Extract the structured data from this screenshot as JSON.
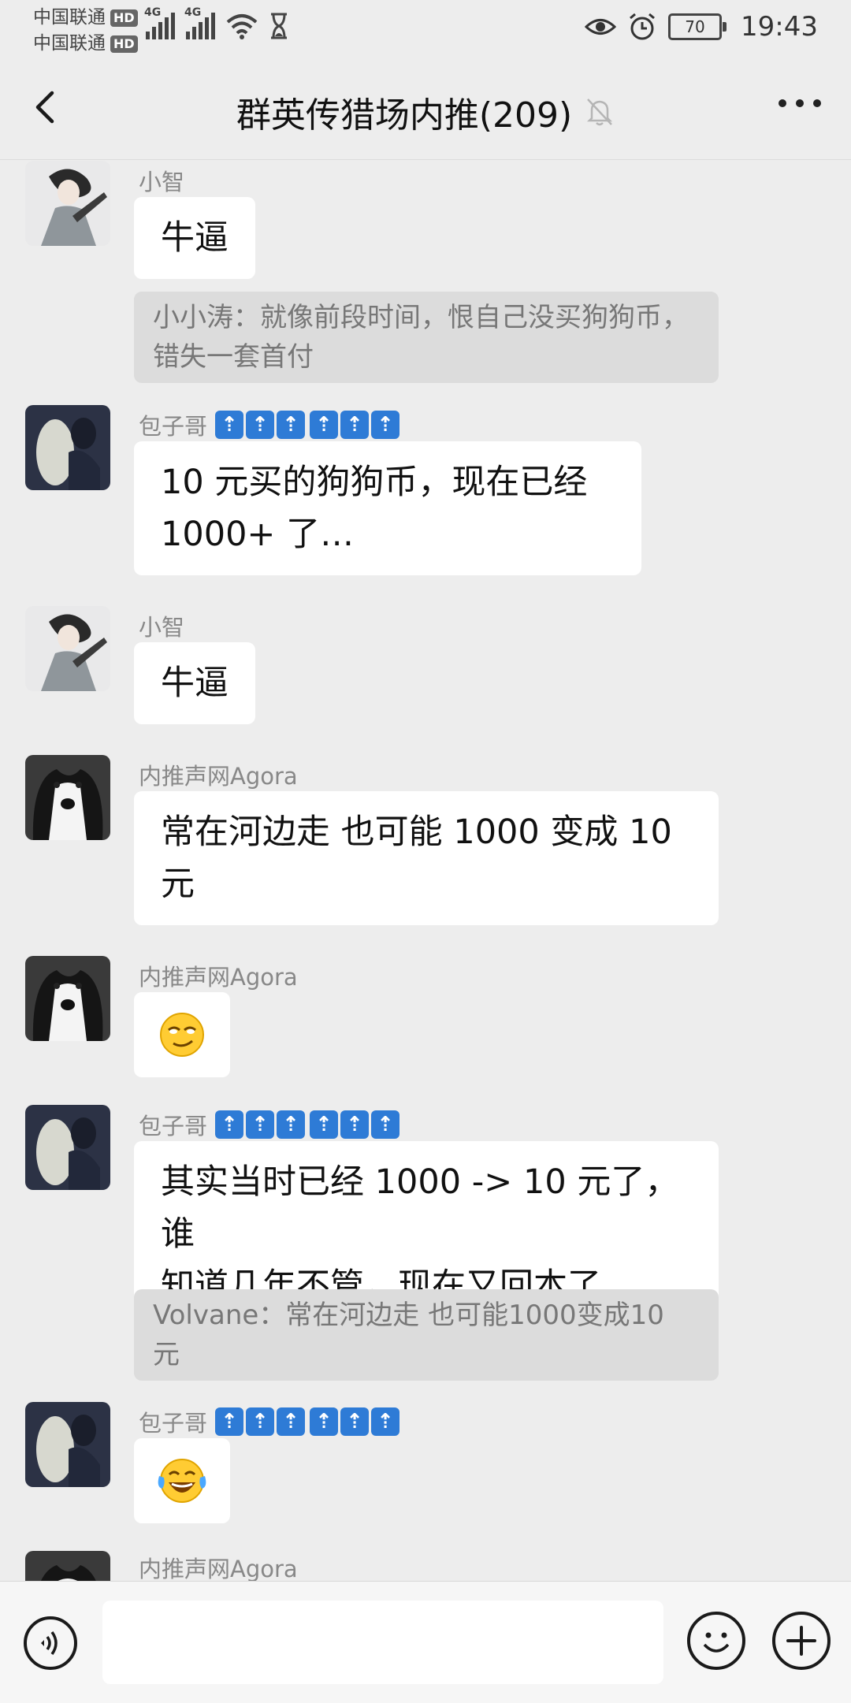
{
  "status_bar": {
    "carrier1": "中国联通",
    "carrier2": "中国联通",
    "hd_label": "HD",
    "network_tag": "4G",
    "battery": "70",
    "time": "19:43"
  },
  "header": {
    "title": "群英传猎场内推(209)",
    "back_icon": "chevron-left-icon",
    "mute_icon": "bell-off-icon",
    "more_icon": "more-dots-icon"
  },
  "messages": [
    {
      "sender": "小智",
      "text": "牛逼"
    },
    {
      "quote": "小小涛：就像前段时间，恨自己没买狗狗币，错失一套首付"
    },
    {
      "sender": "包子哥",
      "badge": "⇡",
      "text_line1": "10 元买的狗狗币，现在已经",
      "text_line2": "1000+ 了…"
    },
    {
      "sender": "小智",
      "text": "牛逼"
    },
    {
      "sender": "内推声网Agora",
      "text_line1": "常在河边走 也可能 1000 变成 10",
      "text_line2": "元"
    },
    {
      "sender": "内推声网Agora",
      "emoji": "smirk-face-emoji"
    },
    {
      "sender": "包子哥",
      "badge": "⇡",
      "text_line1": "其实当时已经 1000 -> 10 元了，谁",
      "text_line2": "知道几年不管，现在又回本了"
    },
    {
      "quote_line1": "Volvane：常在河边走 也可能1000变成10",
      "quote_line2": "元"
    },
    {
      "sender": "包子哥",
      "badge": "⇡",
      "emoji": "tears-of-joy-emoji"
    },
    {
      "sender": "内推声网Agora"
    }
  ],
  "input_bar": {
    "voice_icon": "voice-icon",
    "emoji_icon": "emoji-icon",
    "plus_icon": "plus-icon",
    "placeholder": ""
  },
  "colors": {
    "background": "#ededed",
    "bubble": "#ffffff",
    "quote": "#dcdcdc",
    "badge": "#2e7bd6"
  }
}
